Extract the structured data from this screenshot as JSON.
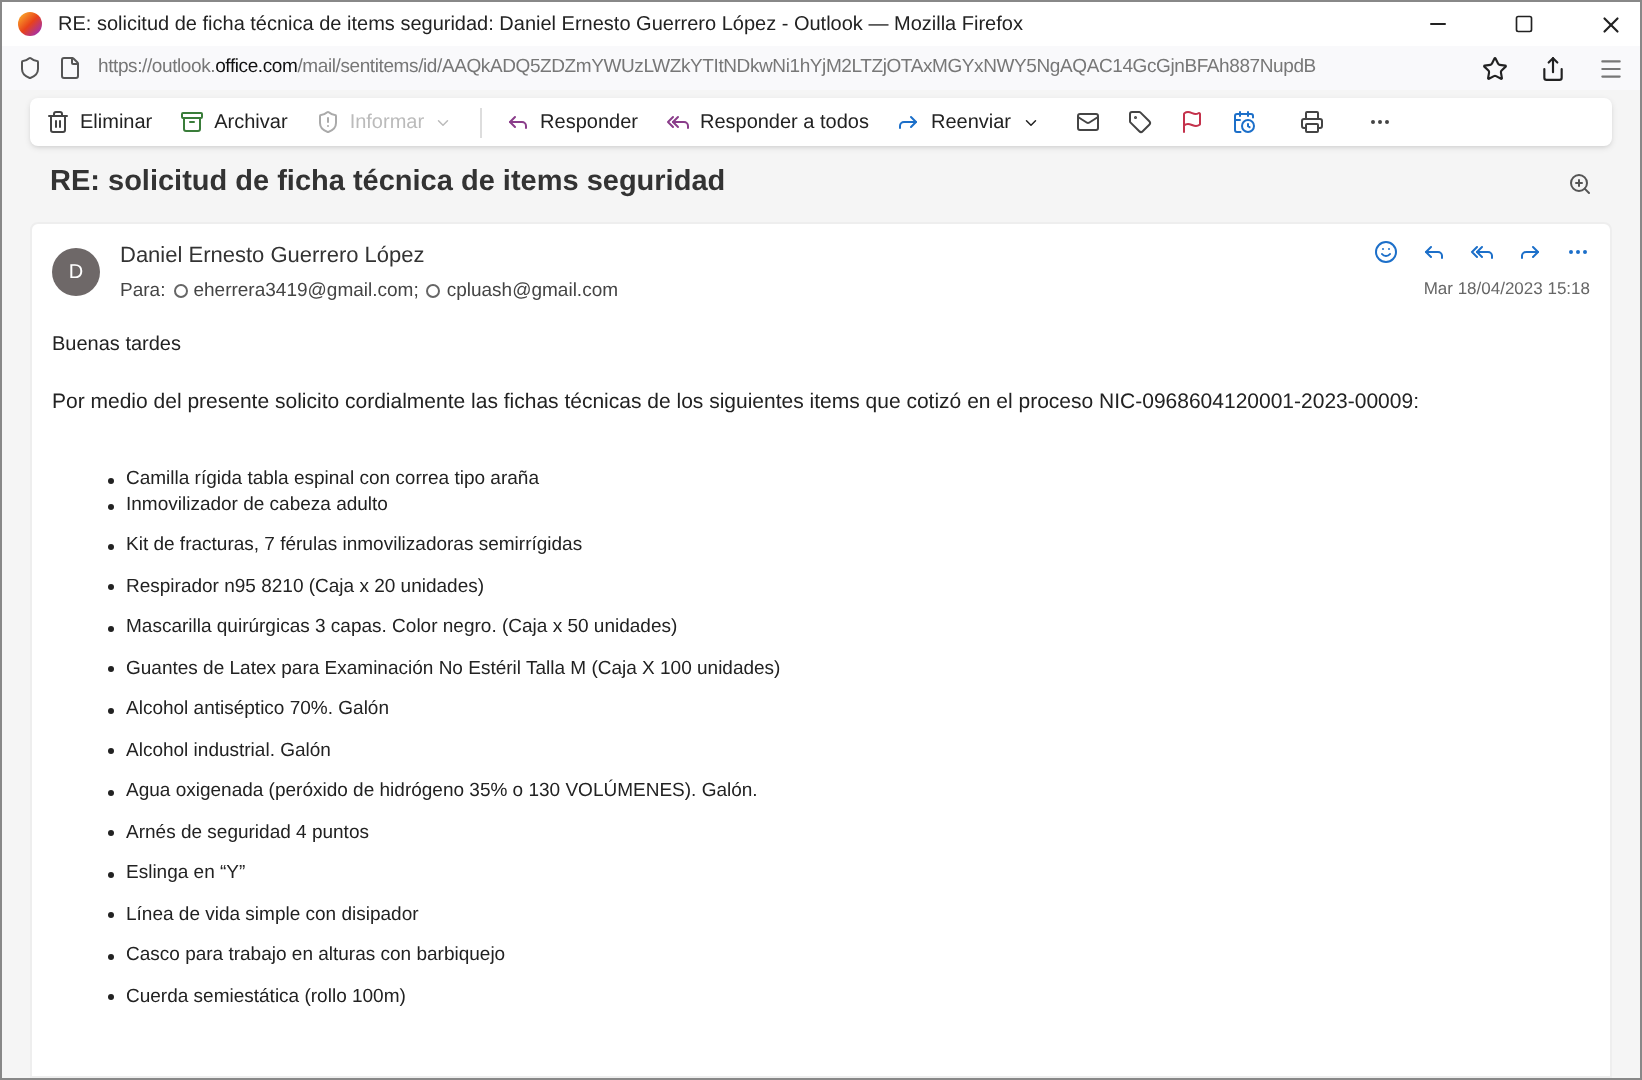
{
  "window": {
    "title": "RE: solicitud de ficha técnica de items seguridad: Daniel Ernesto Guerrero López - Outlook — Mozilla Firefox"
  },
  "address_bar": {
    "url_prefix": "https://outlook.",
    "url_domain": "office.com",
    "url_rest": "/mail/sentitems/id/AAQkADQ5ZDZmYWUzLWZkYTItNDkwNi1hYjM2LTZjOTAxMGYxNWY5NgAQAC14GcGjnBFAh887NupdB"
  },
  "toolbar": [
    {
      "kind": "delete",
      "label": "Eliminar",
      "disabled": false
    },
    {
      "kind": "archive",
      "label": "Archivar",
      "disabled": false
    },
    {
      "kind": "report",
      "label": "Informar",
      "disabled": true
    },
    {
      "kind": "reply",
      "label": "Responder",
      "disabled": false
    },
    {
      "kind": "replyall",
      "label": "Responder a todos",
      "disabled": false
    },
    {
      "kind": "forward",
      "label": "Reenviar",
      "disabled": false
    }
  ],
  "subject": "RE: solicitud de ficha técnica de items seguridad",
  "message": {
    "avatar": "D",
    "sender": "Daniel Ernesto Guerrero López",
    "to_label": "Para:",
    "recipients": [
      "eherrera3419@gmail.com;",
      "cpluash@gmail.com"
    ],
    "date": "Mar 18/04/2023 15:18",
    "greeting": "Buenas tardes",
    "intro": "Por medio del presente solicito cordialmente las fichas técnicas de los siguientes items que cotizó en el proceso NIC-0968604120001-2023-00009:",
    "items": [
      "Camilla rígida tabla espinal con correa tipo araña",
      "Inmovilizador de cabeza adulto",
      "Kit de fracturas, 7  férulas inmovilizadoras semirrígidas",
      "Respirador n95 8210 (Caja x 20 unidades)",
      "Mascarilla quirúrgicas 3 capas. Color negro. (Caja x 50 unidades)",
      "Guantes de Latex para Examinación No Estéril Talla M (Caja X 100 unidades)",
      "Alcohol antiséptico 70%. Galón",
      "Alcohol industrial. Galón",
      "Agua oxigenada (peróxido de hidrógeno 35% o 130 VOLÚMENES). Galón.",
      "Arnés de seguridad 4 puntos",
      "Eslinga en “Y”",
      "Línea de vida simple con disipador",
      "Casco para trabajo en alturas con barbiquejo",
      "Cuerda semiestática (rollo 100m)"
    ]
  }
}
